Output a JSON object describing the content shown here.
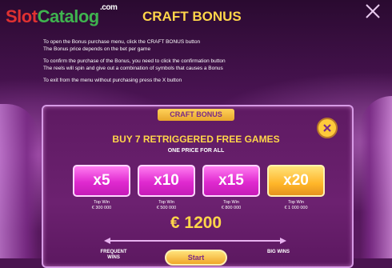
{
  "brand": {
    "slot": "Slot",
    "catalog": "Catalog",
    "com": ".com"
  },
  "header": {
    "title": "CRAFT BONUS"
  },
  "info": {
    "line1": "To open the Bonus purchase menu, click the CRAFT BONUS button",
    "line2": "The Bonus price depends on the bet per game",
    "line3": "To confirm the purchase of the Bonus, you need to click the confirmation button",
    "line4": "The reels will spin and give out a combination of symbols that causes a Bonus",
    "line5": "To exit from the menu without purchasing press the X button"
  },
  "panel": {
    "tab_label": "CRAFT BONUS",
    "heading": "BUY 7 RETRIGGERED FREE GAMES",
    "subheading": "ONE PRICE FOR ALL",
    "options": [
      {
        "label": "x5",
        "win_label": "Top Win",
        "win_value": "€ 300 000",
        "selected": false
      },
      {
        "label": "x10",
        "win_label": "Top Win",
        "win_value": "€ 500 000",
        "selected": false
      },
      {
        "label": "x15",
        "win_label": "Top Win",
        "win_value": "€ 800 000",
        "selected": false
      },
      {
        "label": "x20",
        "win_label": "Top Win",
        "win_value": "€ 1 000 000",
        "selected": true
      }
    ],
    "price": "€ 1200",
    "scale_left": "FREQUENT WINS",
    "scale_right": "BIG WINS",
    "start_label": "Start"
  },
  "colors": {
    "accent": "#ffd54a",
    "panel": "#5e1a62",
    "option": "#e02ad0",
    "selected": "#ffb629"
  },
  "icons": {
    "close": "close-icon",
    "panel_close": "close-circle-icon"
  }
}
